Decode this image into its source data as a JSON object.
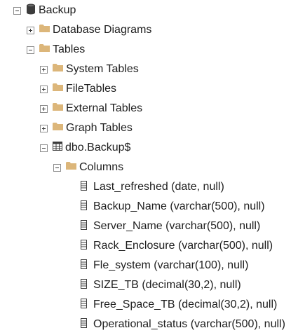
{
  "tree": {
    "root": {
      "label": "Backup",
      "icon": "database-icon",
      "expanded": true
    },
    "database_diagrams": {
      "label": "Database Diagrams",
      "icon": "folder-icon",
      "expanded": false
    },
    "tables": {
      "label": "Tables",
      "icon": "folder-icon",
      "expanded": true
    },
    "system_tables": {
      "label": "System Tables",
      "icon": "folder-icon",
      "expanded": false
    },
    "file_tables": {
      "label": "FileTables",
      "icon": "folder-icon",
      "expanded": false
    },
    "external_tables": {
      "label": "External Tables",
      "icon": "folder-icon",
      "expanded": false
    },
    "graph_tables": {
      "label": "Graph Tables",
      "icon": "folder-icon",
      "expanded": false
    },
    "backup_table": {
      "label": "dbo.Backup$",
      "icon": "table-icon",
      "expanded": true
    },
    "columns_folder": {
      "label": "Columns",
      "icon": "folder-icon",
      "expanded": true
    },
    "columns": [
      {
        "label": "Last_refreshed (date, null)",
        "icon": "column-icon"
      },
      {
        "label": "Backup_Name (varchar(500), null)",
        "icon": "column-icon"
      },
      {
        "label": "Server_Name (varchar(500), null)",
        "icon": "column-icon"
      },
      {
        "label": "Rack_Enclosure (varchar(500), null)",
        "icon": "column-icon"
      },
      {
        "label": "Fle_system (varchar(100), null)",
        "icon": "column-icon"
      },
      {
        "label": "SIZE_TB (decimal(30,2), null)",
        "icon": "column-icon"
      },
      {
        "label": "Free_Space_TB (decimal(30,2), null)",
        "icon": "column-icon"
      },
      {
        "label": "Operational_status (varchar(500), null)",
        "icon": "column-icon"
      }
    ]
  },
  "colors": {
    "folder": "#dcb67a",
    "text": "#1e1e1e",
    "toggle_border": "#8c8c8c",
    "background": "#ffffff"
  }
}
